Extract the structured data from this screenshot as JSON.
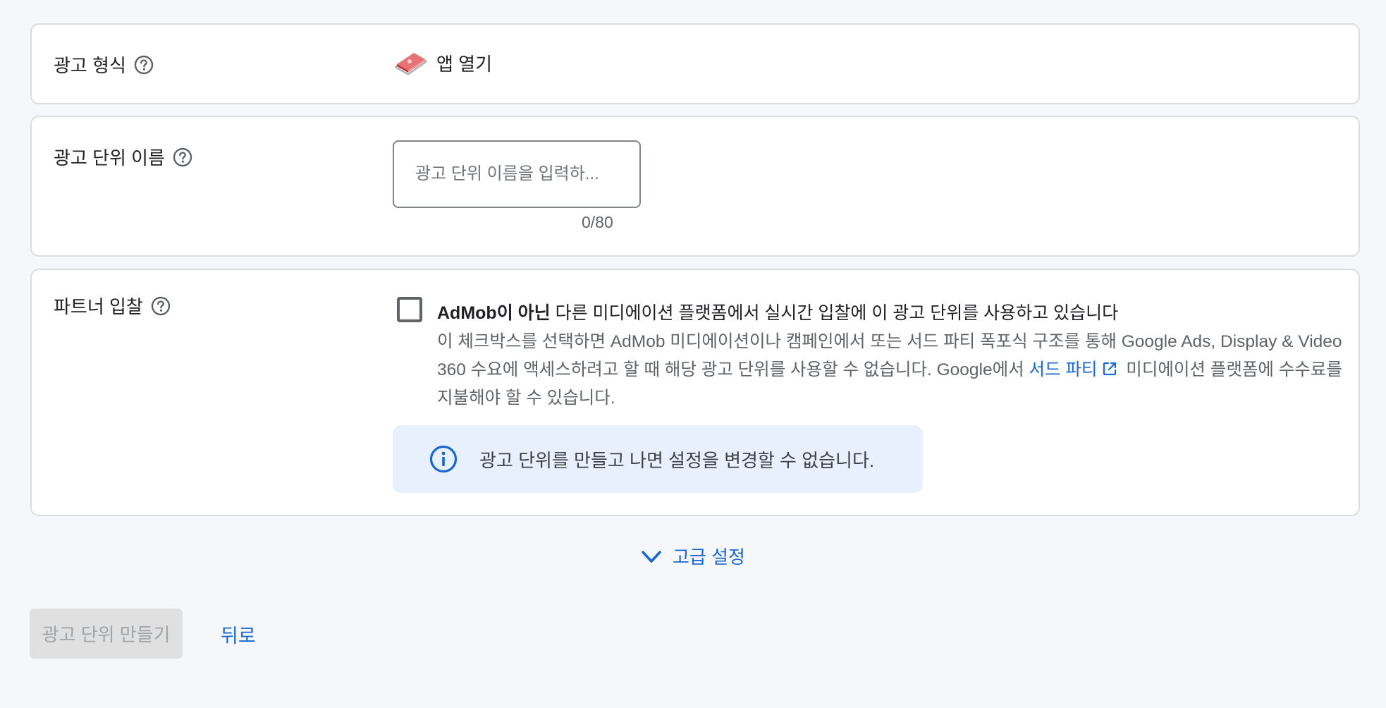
{
  "format_row": {
    "label": "광고 형식",
    "value": "앱 열기",
    "icon": "app-open-icon"
  },
  "name_row": {
    "label": "광고 단위 이름",
    "input_value": "",
    "input_placeholder": "광고 단위 이름을 입력하...",
    "counter": "0/80"
  },
  "bidding_row": {
    "label": "파트너 입찰",
    "checkbox_checked": false,
    "title_bold": "AdMob이 아닌",
    "title_rest": " 다른 미디에이션 플랫폼에서 실시간 입찰에 이 광고 단위를 사용하고 있습니다",
    "description_part1": "이 체크박스를 선택하면 AdMob 미디에이션이나 캠페인에서 또는 서드 파티 폭포식 구조를 통해 Google Ads, Display & Video 360 수요에 액세스하려고 할 때 해당 광고 단위를 사용할 수 없습니다. Google에서 ",
    "description_link": "서드 파티",
    "description_part2": " 미디에이션 플랫폼에 수수료를 지불해야 할 수 있습니다.",
    "info_text": "광고 단위를 만들고 나면 설정을 변경할 수 없습니다."
  },
  "advanced": {
    "label": "고급 설정"
  },
  "actions": {
    "create_label": "광고 단위 만들기",
    "back_label": "뒤로"
  },
  "colors": {
    "accent": "#1967d2",
    "info_background": "#e8f0fe",
    "page_background": "#f5f7fa",
    "disabled_button": "#e0e0e0"
  }
}
